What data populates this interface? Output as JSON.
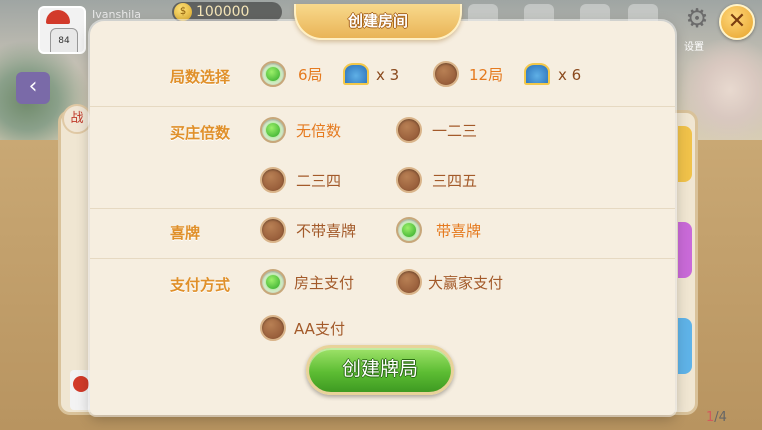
{
  "header": {
    "username": "Ivanshila",
    "avatar_number": "84",
    "coins": "100000",
    "settings_label": "设置",
    "close_symbol": "✕",
    "back_symbol": "‹",
    "side_badge": "战"
  },
  "dialog": {
    "title": "创建房间",
    "rounds": {
      "label": "局数选择",
      "options": [
        {
          "label": "6局",
          "selected": true,
          "cost": "x 3"
        },
        {
          "label": "12局",
          "selected": false,
          "cost": "x 6"
        }
      ]
    },
    "banker": {
      "label": "买庄倍数",
      "options": [
        {
          "label": "无倍数",
          "selected": true
        },
        {
          "label": "一二三",
          "selected": false
        },
        {
          "label": "二三四",
          "selected": false
        },
        {
          "label": "三四五",
          "selected": false
        }
      ]
    },
    "xipai": {
      "label": "喜牌",
      "options": [
        {
          "label": "不带喜牌",
          "selected": false
        },
        {
          "label": "带喜牌",
          "selected": true
        }
      ]
    },
    "payment": {
      "label": "支付方式",
      "options": [
        {
          "label": "房主支付",
          "selected": true
        },
        {
          "label": "大赢家支付",
          "selected": false
        },
        {
          "label": "AA支付",
          "selected": false
        }
      ]
    },
    "create_button": "创建牌局"
  },
  "pager": {
    "current": "1",
    "total": "/4"
  },
  "colors": {
    "accent": "#e0902a",
    "selected_green": "#2fa82a",
    "radio_brown": "#8b5030",
    "button_green": "#5dbd33"
  }
}
